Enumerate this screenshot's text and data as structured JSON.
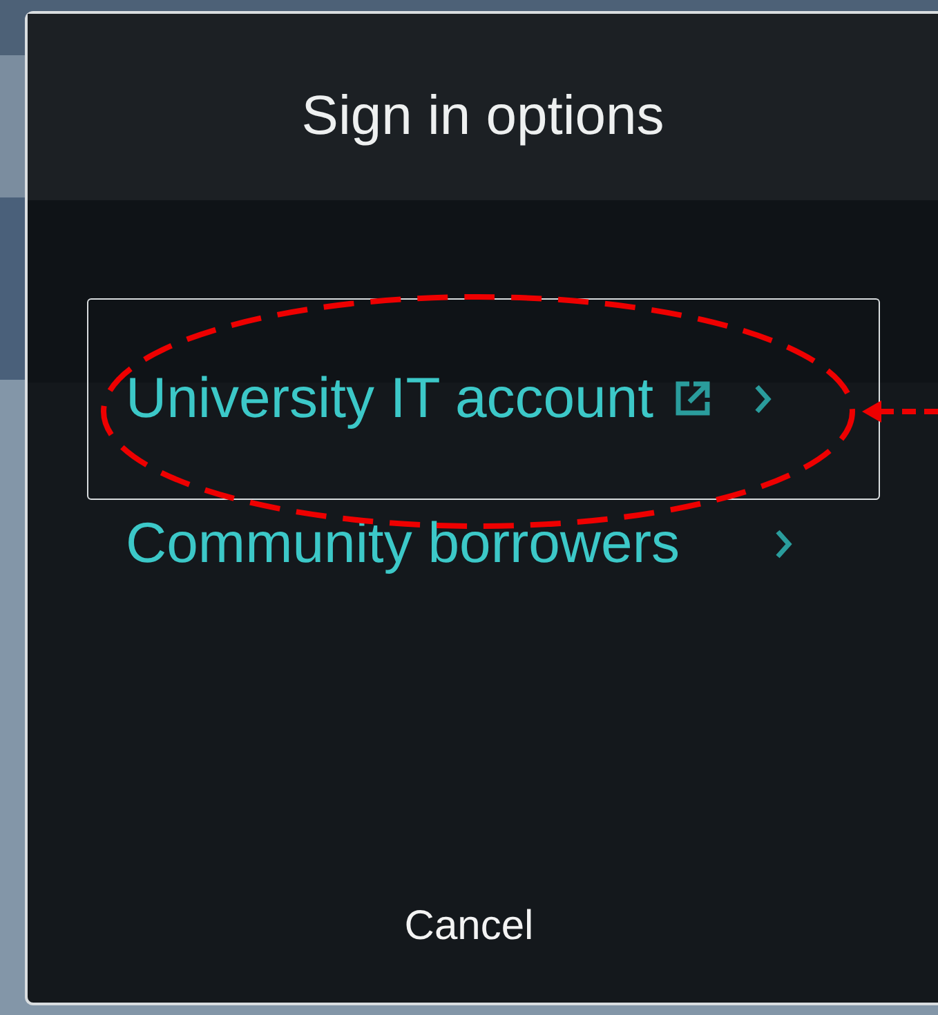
{
  "dialog": {
    "title": "Sign in options",
    "options": [
      {
        "label": "University IT account",
        "external": true,
        "focused": true
      },
      {
        "label": "Community borrowers",
        "external": false,
        "focused": false
      }
    ],
    "cancel": "Cancel"
  }
}
